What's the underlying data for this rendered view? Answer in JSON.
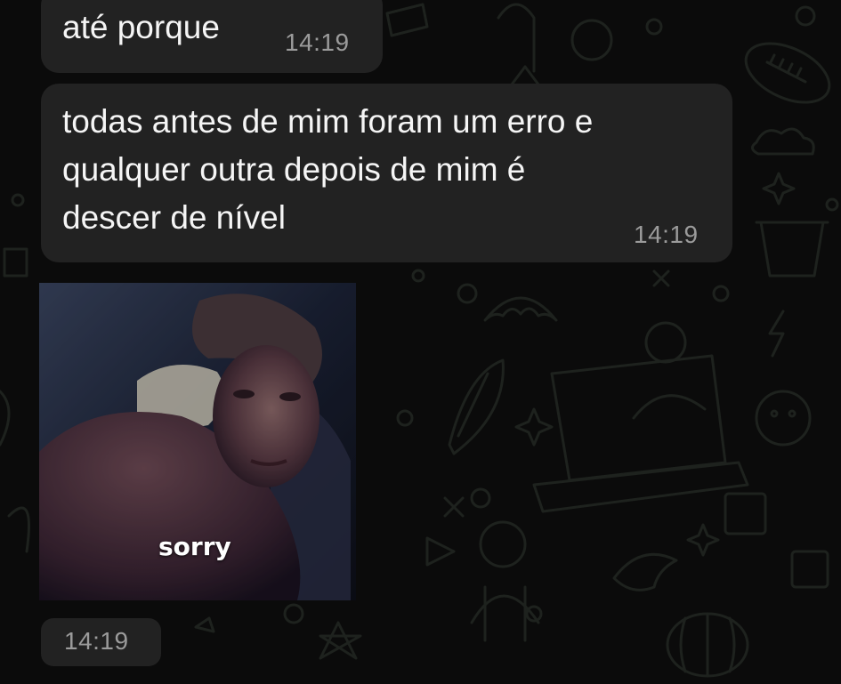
{
  "theme": {
    "background": "#0b0b0b",
    "bubble_color": "#222222",
    "text_color": "#f5f5f5",
    "time_color": "#9b9b9b",
    "doodle_color": "#1f231f"
  },
  "messages": [
    {
      "type": "text",
      "text": "até porque",
      "time": "14:19"
    },
    {
      "type": "text",
      "text": "todas antes de mim foram um erro e\nqualquer outra depois de mim é\ndescer de nível",
      "time": "14:19"
    },
    {
      "type": "sticker",
      "caption": "sorry",
      "time": "14:19"
    }
  ]
}
